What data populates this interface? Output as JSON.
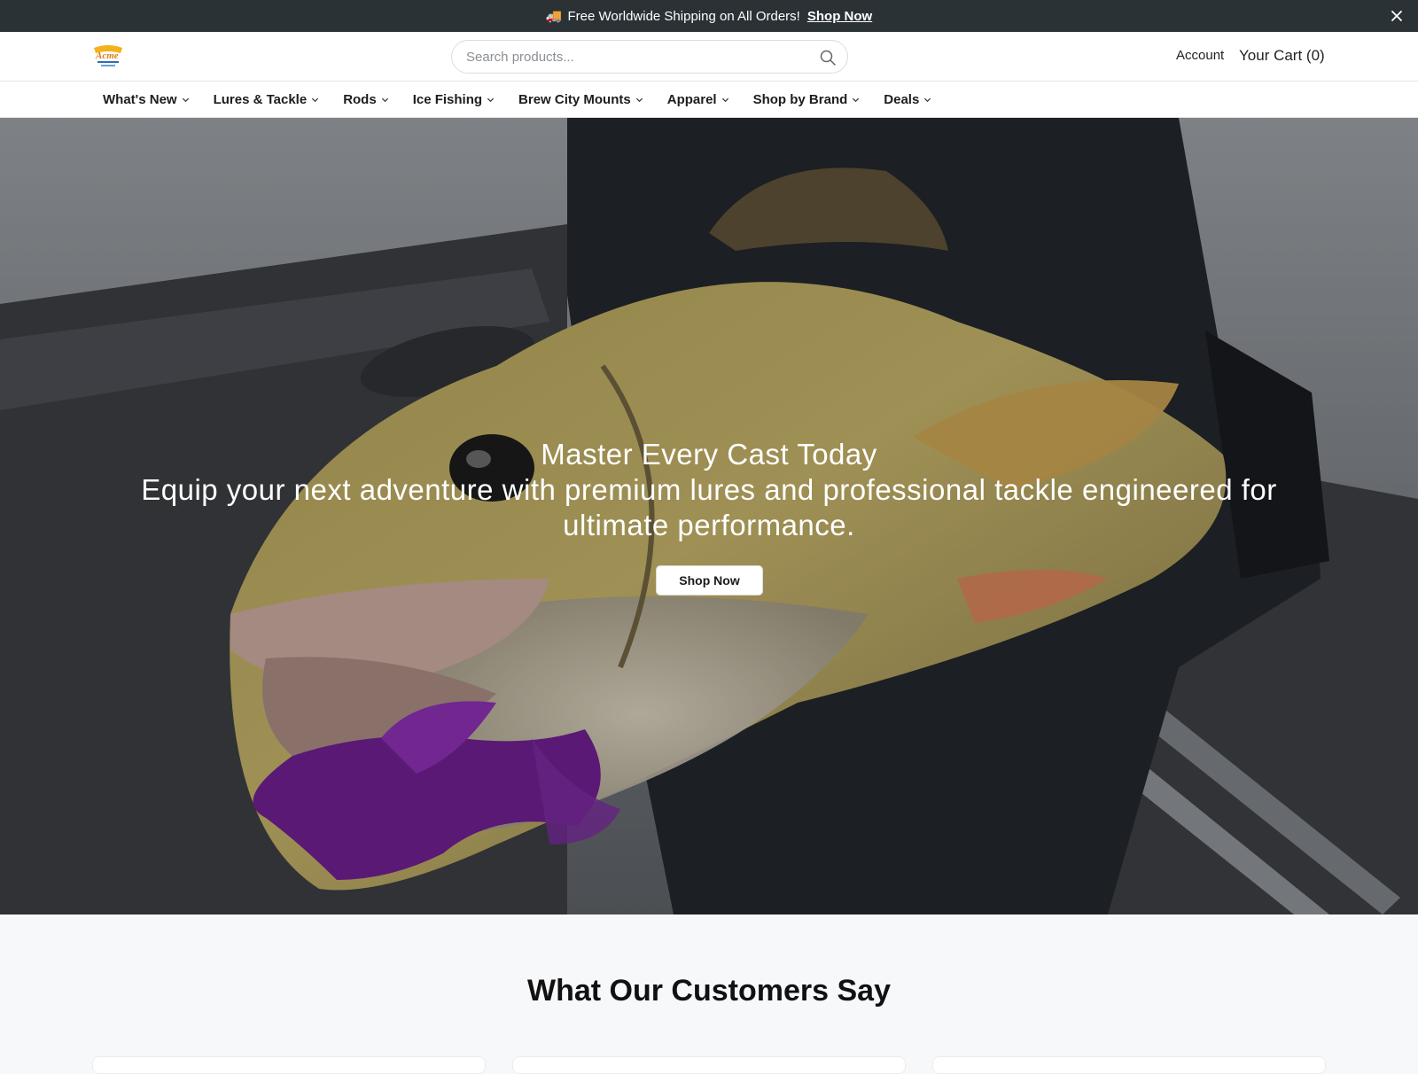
{
  "announcement": {
    "icon": "truck-icon",
    "text": "Free Worldwide Shipping on All Orders!",
    "link": "Shop Now"
  },
  "header": {
    "logo_text": "Acme",
    "search_placeholder": "Search products...",
    "account_label": "Account",
    "cart_label": "Your Cart (0)"
  },
  "nav": {
    "items": [
      {
        "label": "What's New"
      },
      {
        "label": "Lures & Tackle"
      },
      {
        "label": "Rods"
      },
      {
        "label": "Ice Fishing"
      },
      {
        "label": "Brew City Mounts"
      },
      {
        "label": "Apparel"
      },
      {
        "label": "Shop by Brand"
      },
      {
        "label": "Deals"
      }
    ]
  },
  "hero": {
    "title": "Master Every Cast Today",
    "subtitle": "Equip your next adventure with premium lures and professional tackle engineered for ultimate performance.",
    "button_label": "Shop Now"
  },
  "testimonials": {
    "title": "What Our Customers Say"
  },
  "colors": {
    "announce_bg": "#2a3236",
    "header_bg": "#ffffff",
    "page_bg": "#f7f8fa"
  }
}
